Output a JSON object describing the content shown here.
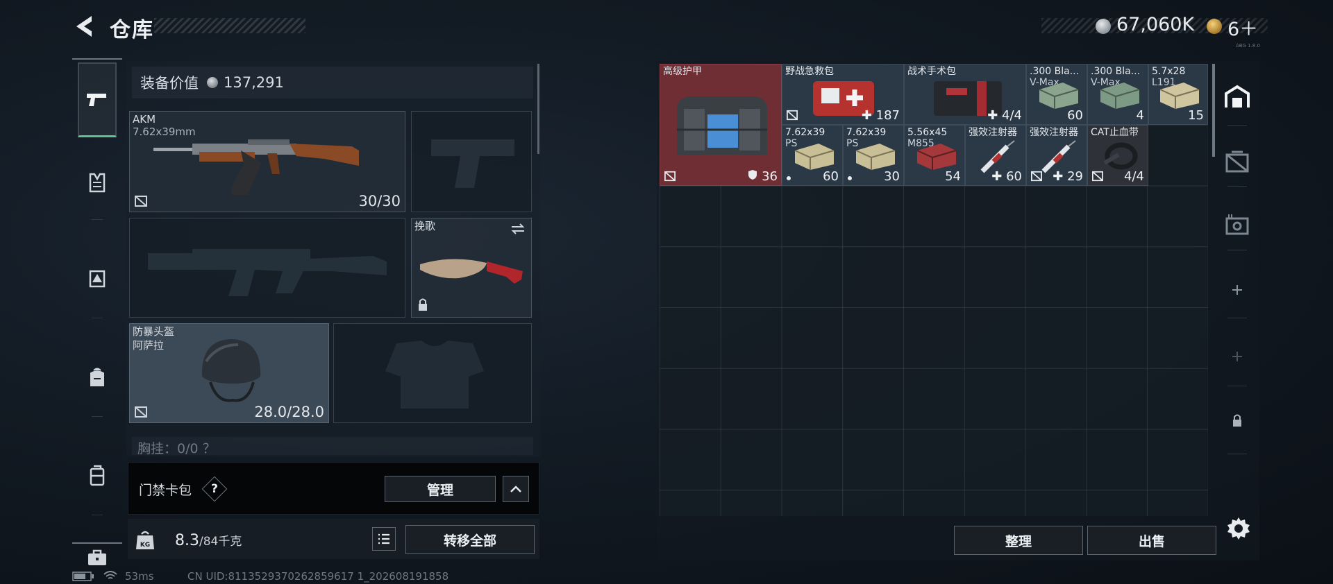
{
  "header": {
    "title": "仓库",
    "currency_silver": "67,060K",
    "currency_gold": "6＋",
    "build": "ABG 1.8.0"
  },
  "equipment": {
    "value_label": "装备价值",
    "value": "137,291",
    "primary_weapon": {
      "name": "AKM",
      "caliber": "7.62x39mm",
      "ammo": "30/30"
    },
    "melee": {
      "name": "挽歌"
    },
    "helmet": {
      "name": "防暴头盔",
      "sub": "阿萨拉",
      "durability": "28.0/28.0"
    },
    "chest_rig": {
      "label": "胸挂：0/0 ？"
    }
  },
  "keycard": {
    "label": "门禁卡包",
    "help": "?",
    "manage_label": "管理"
  },
  "footer_left": {
    "weight_current": "8.3",
    "weight_max": "/84千克",
    "transfer_label": "转移全部"
  },
  "storage": {
    "items": [
      {
        "name": "高级护甲",
        "count": "36"
      },
      {
        "name": "野战急救包",
        "count": "187"
      },
      {
        "name": "战术手术包",
        "count": "4/4"
      },
      {
        "name": ".300 Bla...",
        "name2": "V-Max",
        "count": "60"
      },
      {
        "name": ".300 Bla...",
        "name2": "V-Max",
        "count": "4"
      },
      {
        "name": "5.7x28",
        "name2": "L191",
        "count": "15"
      },
      {
        "name": "7.62x39",
        "name2": "PS",
        "count": "60"
      },
      {
        "name": "7.62x39",
        "name2": "PS",
        "count": "30"
      },
      {
        "name": "5.56x45",
        "name2": "M855",
        "count": "54"
      },
      {
        "name": "强效注射器",
        "count": "60"
      },
      {
        "name": "强效注射器",
        "count": "29"
      },
      {
        "name": "CAT止血带",
        "count": "4/4"
      }
    ],
    "sort_label": "整理",
    "sell_label": "出售"
  },
  "status": {
    "ping": "53ms",
    "uid": "CN UID:8113529370262859617 1_202608191858"
  },
  "colors": {
    "accent_green": "#5fc48f",
    "armor_red": "#6e2e34",
    "panel_bg": "#182029"
  }
}
